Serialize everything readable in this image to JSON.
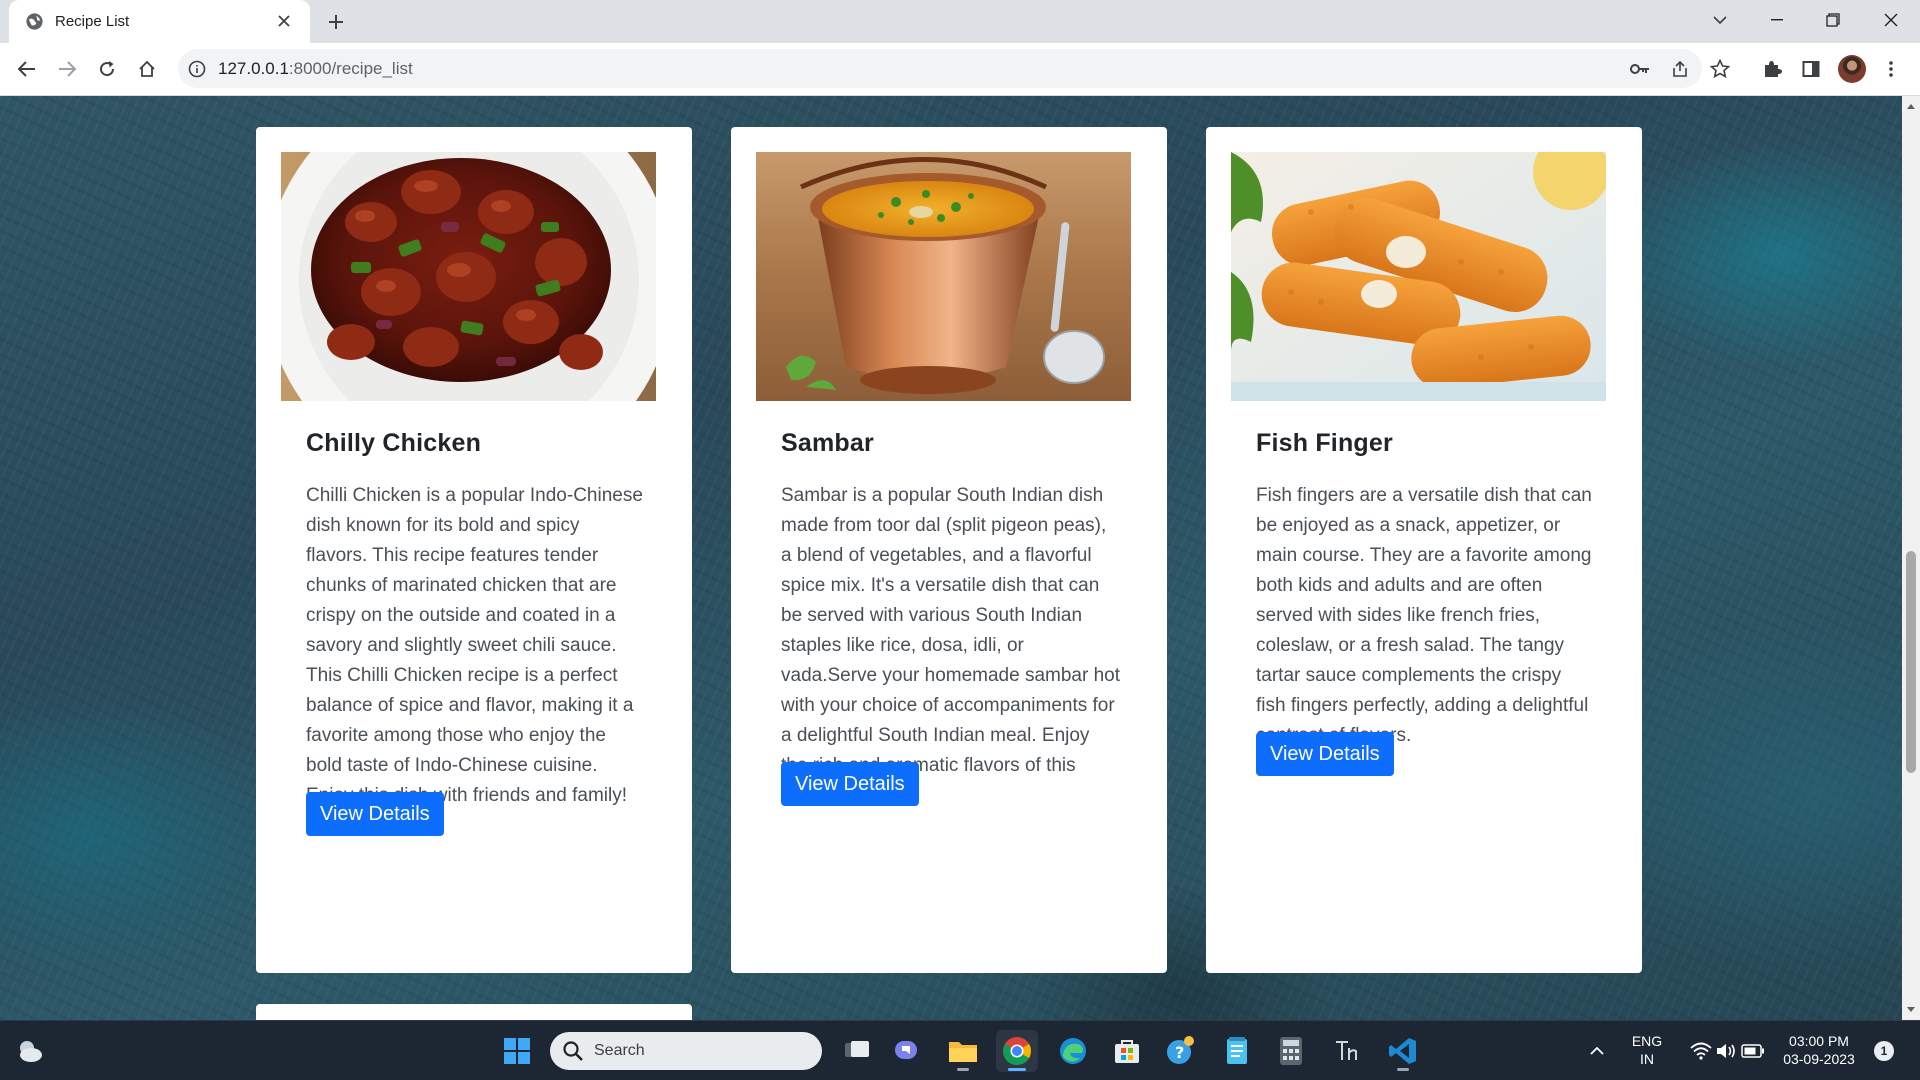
{
  "browser": {
    "tab_title": "Recipe List",
    "url_host": "127.0.0.1",
    "url_rest": ":8000/recipe_list"
  },
  "recipes": [
    {
      "name": "Chilly Chicken",
      "description": "Chilli Chicken is a popular Indo-Chinese dish known for its bold and spicy flavors. This recipe features tender chunks of marinated chicken that are crispy on the outside and coated in a savory and slightly sweet chili sauce. This Chilli Chicken recipe is a perfect balance of spice and flavor, making it a favorite among those who enjoy the bold taste of Indo-Chinese cuisine. Enjoy this dish with friends and family!",
      "button": "View Details"
    },
    {
      "name": "Sambar",
      "description": "Sambar is a popular South Indian dish made from toor dal (split pigeon peas), a blend of vegetables, and a flavorful spice mix. It's a versatile dish that can be served with various South Indian staples like rice, dosa, idli, or vada.Serve your homemade sambar hot with your choice of accompaniments for a delightful South Indian meal. Enjoy the rich and aromatic flavors of this classic dish!",
      "button": "View Details"
    },
    {
      "name": "Fish Finger",
      "description": "Fish fingers are a versatile dish that can be enjoyed as a snack, appetizer, or main course. They are a favorite among both kids and adults and are often served with sides like french fries, coleslaw, or a fresh salad. The tangy tartar sauce complements the crispy fish fingers perfectly, adding a delightful contrast of flavors.",
      "button": "View Details"
    }
  ],
  "taskbar": {
    "search_label": "Search",
    "lang_line1": "ENG",
    "lang_line2": "IN",
    "time": "03:00 PM",
    "date": "03-09-2023",
    "notification_count": "1",
    "button_primary_color": "#0d6efd"
  }
}
